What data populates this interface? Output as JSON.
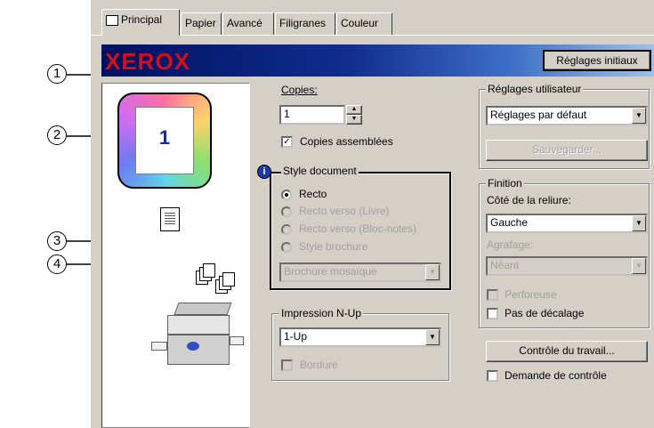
{
  "tabs": [
    "Principal",
    "Papier",
    "Avancé",
    "Filigranes",
    "Couleur"
  ],
  "banner": {
    "logo": "XEROX",
    "reset_button": "Réglages initiaux"
  },
  "callouts": [
    "1",
    "2",
    "3",
    "4"
  ],
  "preview": {
    "page_number": "1"
  },
  "copies": {
    "label": "Copies:",
    "value": "1"
  },
  "collate": {
    "label": "Copies assemblées",
    "checked": true
  },
  "document_style": {
    "title": "Style document",
    "options": [
      "Recto",
      "Recto verso (Livre)",
      "Recto verso (Bloc-notes)",
      "Style brochure"
    ],
    "selected": "Recto",
    "brochure_select": "Brochure mosaïque"
  },
  "nup": {
    "title": "Impression N-Up",
    "value": "1-Up",
    "border_label": "Bordure"
  },
  "user_settings": {
    "title": "Réglages utilisateur",
    "value": "Réglages par défaut",
    "save_button": "Sauvegarder..."
  },
  "finishing": {
    "title": "Finition",
    "binding_label": "Côté de la reliure:",
    "binding_value": "Gauche",
    "staple_label": "Agrafage:",
    "staple_value": "Néant",
    "punch_label": "Perforeuse",
    "offset_label": "Pas de décalage"
  },
  "job_control": {
    "button": "Contrôle du travail...",
    "request_label": "Demande de contrôle"
  }
}
